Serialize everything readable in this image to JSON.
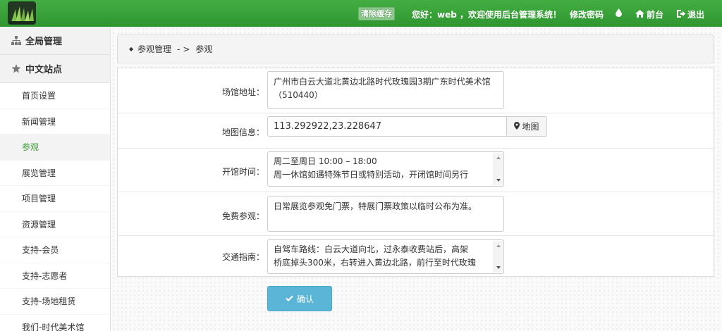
{
  "header": {
    "clear_cache": "清除缓存",
    "welcome": "您好：web ，欢迎使用后台管理系统！",
    "change_password": "修改密码",
    "front": "前台",
    "logout": "退出",
    "bg_color": "#3aa13a"
  },
  "sidebar": {
    "global_title": "全局管理",
    "site_title": "中文站点",
    "items": [
      {
        "label": "首页设置"
      },
      {
        "label": "新闻管理"
      },
      {
        "label": "参观"
      },
      {
        "label": "展览管理"
      },
      {
        "label": "项目管理"
      },
      {
        "label": "资源管理"
      },
      {
        "label": "支持-会员"
      },
      {
        "label": "支持-志愿者"
      },
      {
        "label": "支持-场地租赁"
      },
      {
        "label": "我们-时代美术馆"
      }
    ],
    "active_color": "#3a9a3a"
  },
  "breadcrumb": {
    "parent": "参观管理",
    "separator": "- >",
    "current": "参观"
  },
  "form": {
    "address": {
      "label": "场馆地址：",
      "value": "广州市白云大道北黄边北路时代玫瑰园3期广东时代美术馆（510440）"
    },
    "map": {
      "label": "地图信息：",
      "value": "113.292922,23.228647",
      "button": "地图"
    },
    "hours": {
      "label": "开馆时间：",
      "line1": "周二至周日 10:00 – 18:00",
      "line2": "周一休馆如遇特殊节日或特别活动，开闭馆时间另行"
    },
    "free": {
      "label": "免费参观：",
      "value": "日常展览参观免门票，特展门票政策以临时公布为准。"
    },
    "traffic": {
      "label": "交通指南：",
      "line1": "自驾车路线：白云大道向北，过永泰收费站后，高架",
      "line2": "桥底掉头300米，右转进入黄边北路，前行至时代玫瑰"
    },
    "confirm": "确认",
    "confirm_color": "#5bb5d6"
  }
}
